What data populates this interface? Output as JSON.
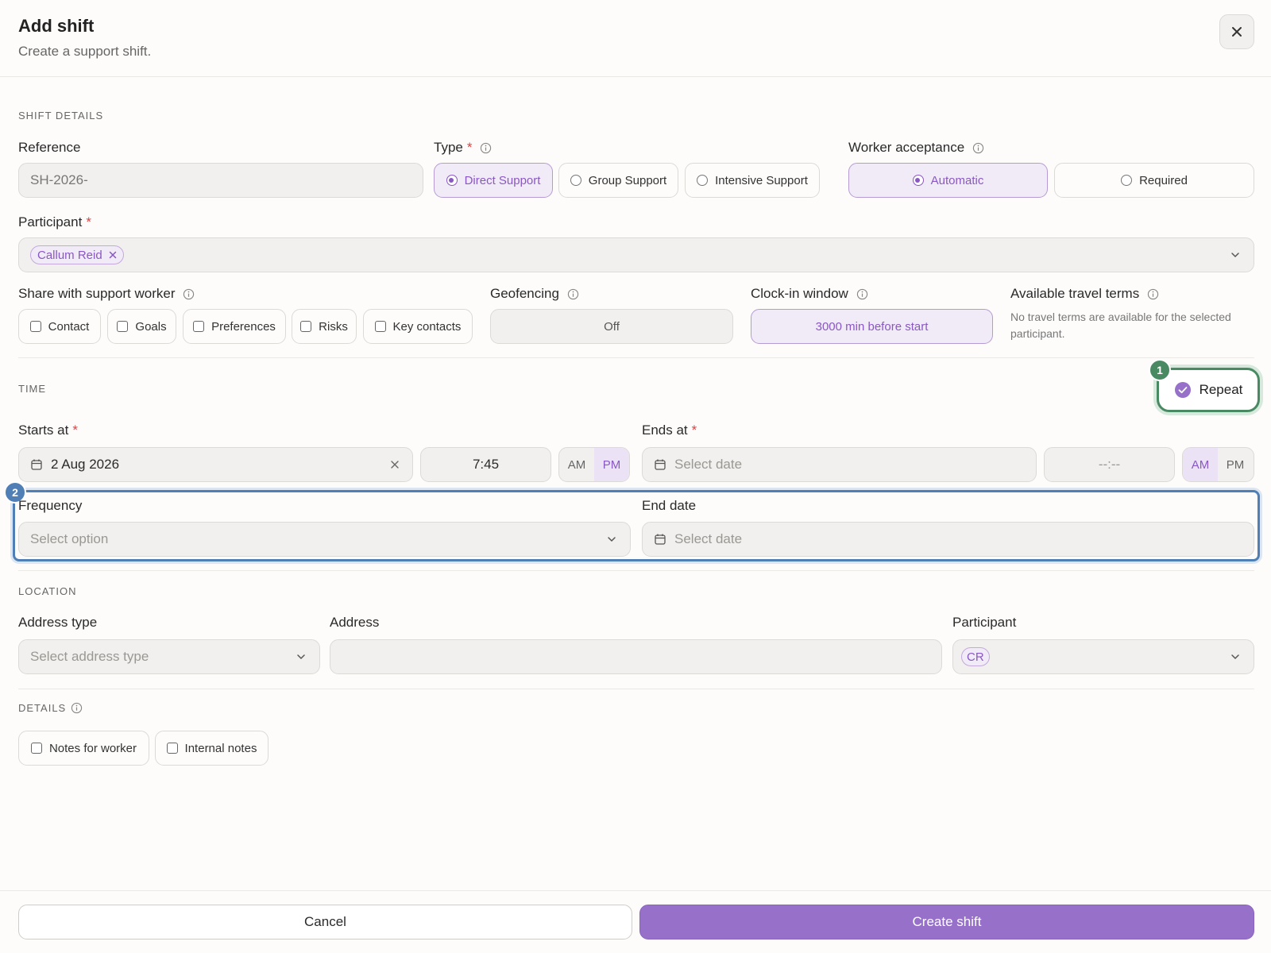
{
  "header": {
    "title": "Add shift",
    "subtitle": "Create a support shift."
  },
  "shift_details": {
    "section_title": "SHIFT DETAILS",
    "reference": {
      "label": "Reference",
      "value": "SH-2026-"
    },
    "type": {
      "label": "Type",
      "options": [
        "Direct Support",
        "Group Support",
        "Intensive Support"
      ],
      "selected": "Direct Support"
    },
    "worker_acceptance": {
      "label": "Worker acceptance",
      "options": [
        "Automatic",
        "Required"
      ],
      "selected": "Automatic"
    },
    "participant": {
      "label": "Participant",
      "chip": "Callum Reid"
    },
    "share": {
      "label": "Share with support worker",
      "options": [
        "Contact",
        "Goals",
        "Preferences",
        "Risks",
        "Key contacts"
      ]
    },
    "geofencing": {
      "label": "Geofencing",
      "value": "Off"
    },
    "clock_in": {
      "label": "Clock-in window",
      "value": "3000 min before start"
    },
    "travel": {
      "label": "Available travel terms",
      "note": "No travel terms are available for the selected participant."
    }
  },
  "time": {
    "section_title": "TIME",
    "repeat_label": "Repeat",
    "starts_at": {
      "label": "Starts at",
      "date": "2 Aug 2026",
      "time": "7:45",
      "am": "AM",
      "pm": "PM",
      "meridiem": "PM"
    },
    "ends_at": {
      "label": "Ends at",
      "date_placeholder": "Select date",
      "time_placeholder": "--:--",
      "am": "AM",
      "pm": "PM",
      "meridiem": "AM"
    },
    "frequency": {
      "label": "Frequency",
      "placeholder": "Select option"
    },
    "end_date": {
      "label": "End date",
      "placeholder": "Select date"
    }
  },
  "location": {
    "section_title": "LOCATION",
    "address_type": {
      "label": "Address type",
      "placeholder": "Select address type"
    },
    "address": {
      "label": "Address",
      "value": ""
    },
    "participant": {
      "label": "Participant",
      "chip": "CR"
    }
  },
  "details": {
    "section_title": "DETAILS",
    "options": [
      "Notes for worker",
      "Internal notes"
    ]
  },
  "footer": {
    "cancel": "Cancel",
    "create": "Create shift"
  },
  "annotations": {
    "badge_1": "1",
    "badge_2": "2"
  },
  "colors": {
    "accent": "#9670c9",
    "accent_light": "#f1eaf7",
    "highlight_green": "#4a8a63",
    "highlight_blue": "#4f7fb5"
  }
}
